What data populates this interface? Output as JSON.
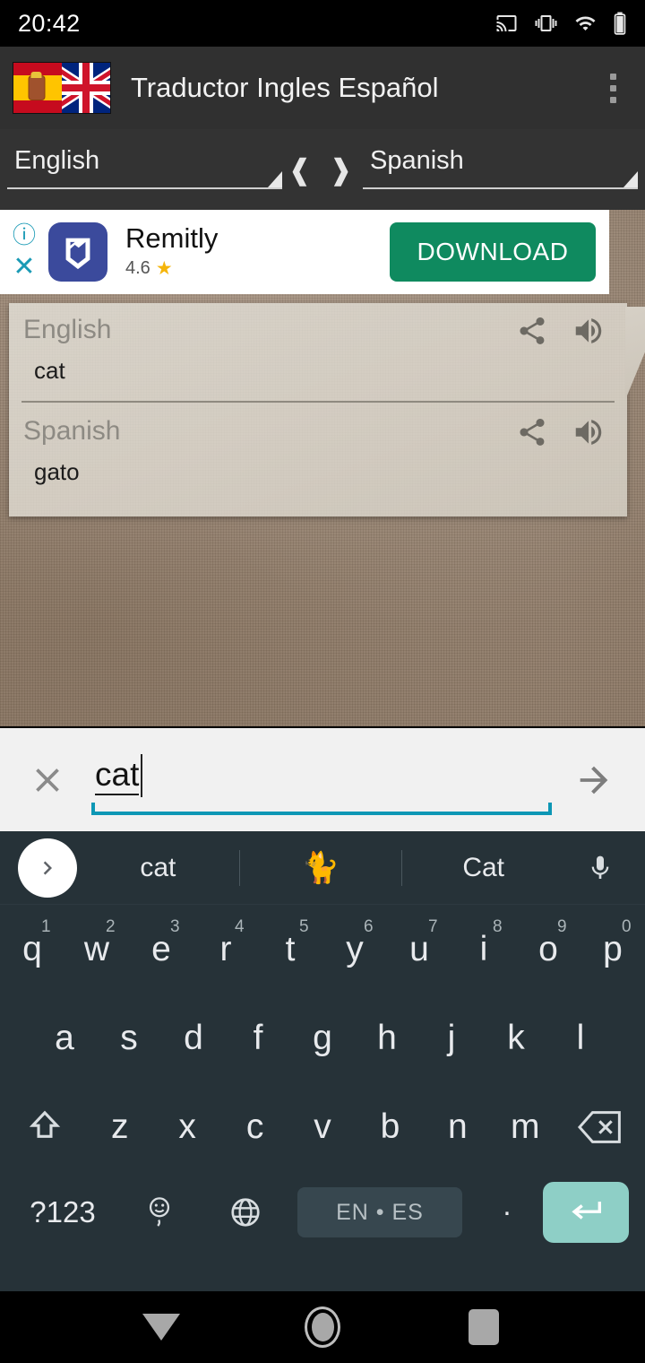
{
  "status_bar": {
    "time": "20:42",
    "icons": [
      "cast-icon",
      "vibrate-icon",
      "wifi-icon",
      "battery-icon"
    ]
  },
  "app_bar": {
    "title": "Traductor Ingles Español",
    "icon": "spain-uk-flags-icon",
    "overflow": "overflow-menu-icon"
  },
  "language_bar": {
    "source": "English",
    "target": "Spanish",
    "swap_glyph": "❰ ❱"
  },
  "ad": {
    "app_name": "Remitly",
    "rating": "4.6",
    "star": "★",
    "cta": "DOWNLOAD",
    "info_glyph": "ⓘ",
    "close_glyph": "✕",
    "cta_color": "#0f8a5f"
  },
  "card": {
    "source": {
      "language": "English",
      "text": "cat"
    },
    "target": {
      "language": "Spanish",
      "text": "gato"
    },
    "actions": [
      "share-icon",
      "speaker-icon"
    ]
  },
  "input_bar": {
    "value": "cat",
    "clear_icon": "clear-icon",
    "submit_icon": "arrow-right-icon",
    "accent": "#0d97b5"
  },
  "keyboard": {
    "suggestions": [
      "cat",
      "🐈",
      "Cat"
    ],
    "toggle_icon": "chevron-right-icon",
    "mic_icon": "microphone-icon",
    "row1": [
      {
        "key": "q",
        "num": "1"
      },
      {
        "key": "w",
        "num": "2"
      },
      {
        "key": "e",
        "num": "3"
      },
      {
        "key": "r",
        "num": "4"
      },
      {
        "key": "t",
        "num": "5"
      },
      {
        "key": "y",
        "num": "6"
      },
      {
        "key": "u",
        "num": "7"
      },
      {
        "key": "i",
        "num": "8"
      },
      {
        "key": "o",
        "num": "9"
      },
      {
        "key": "p",
        "num": "0"
      }
    ],
    "row2": [
      "a",
      "s",
      "d",
      "f",
      "g",
      "h",
      "j",
      "k",
      "l"
    ],
    "row3": [
      "z",
      "x",
      "c",
      "v",
      "b",
      "n",
      "m"
    ],
    "shift_icon": "shift-icon",
    "backspace_icon": "backspace-icon",
    "symbols_label": "?123",
    "emoji_icon": "emoji-icon",
    "emoji_alt": ",",
    "globe_icon": "globe-icon",
    "space_label": "EN • ES",
    "period_label": ".",
    "enter_icon": "enter-icon",
    "enter_color": "#8ecfc6"
  },
  "nav_bar": {
    "back": "back-nav-icon",
    "home": "home-nav-icon",
    "recents": "recents-nav-icon"
  }
}
